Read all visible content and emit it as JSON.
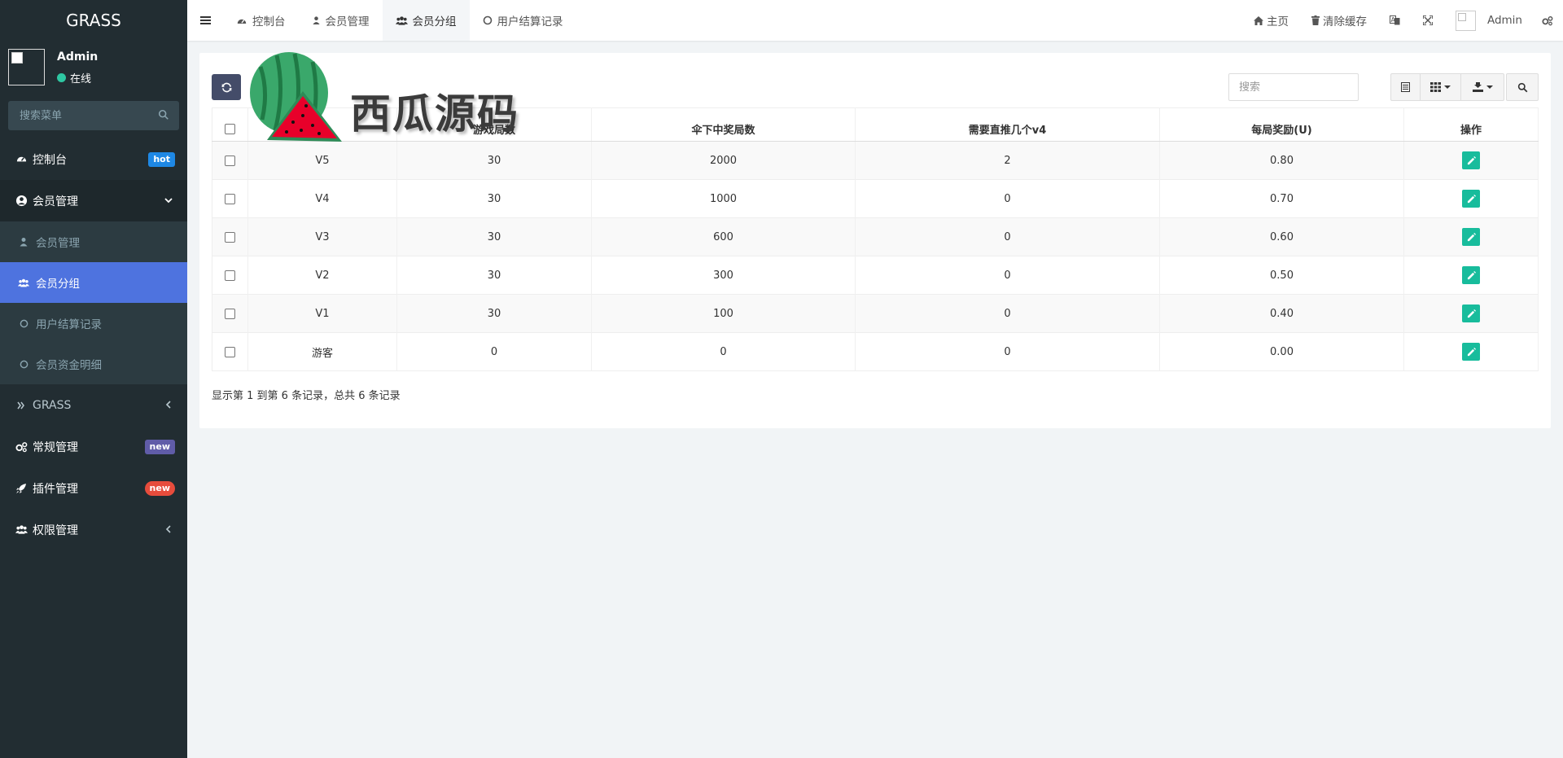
{
  "sidebar": {
    "logo": "GRASS",
    "user": {
      "name": "Admin",
      "status": "在线"
    },
    "search_placeholder": "搜索菜单",
    "items": {
      "dashboard": {
        "label": "控制台",
        "badge": "hot"
      },
      "member": {
        "label": "会员管理"
      },
      "member_sub": [
        {
          "label": "会员管理"
        },
        {
          "label": "会员分组"
        },
        {
          "label": "用户结算记录"
        },
        {
          "label": "会员资金明细"
        }
      ],
      "grass": {
        "label": "GRASS"
      },
      "general": {
        "label": "常规管理",
        "badge": "new"
      },
      "addon": {
        "label": "插件管理",
        "badge": "new"
      },
      "auth": {
        "label": "权限管理"
      }
    }
  },
  "header": {
    "tabs": [
      {
        "label": "控制台"
      },
      {
        "label": "会员管理"
      },
      {
        "label": "会员分组"
      },
      {
        "label": "用户结算记录"
      }
    ],
    "home": "主页",
    "clear_cache": "清除缓存",
    "admin": "Admin"
  },
  "toolbar": {
    "search_placeholder": "搜索"
  },
  "watermark": "西瓜源码",
  "table": {
    "headers": [
      "游戏局数",
      "伞下中奖局数",
      "需要直推几个v4",
      "每局奖励(U)",
      "操作"
    ],
    "rows": [
      {
        "name": "V5",
        "games": "30",
        "wins": "2000",
        "direct": "2",
        "reward": "0.80"
      },
      {
        "name": "V4",
        "games": "30",
        "wins": "1000",
        "direct": "0",
        "reward": "0.70"
      },
      {
        "name": "V3",
        "games": "30",
        "wins": "600",
        "direct": "0",
        "reward": "0.60"
      },
      {
        "name": "V2",
        "games": "30",
        "wins": "300",
        "direct": "0",
        "reward": "0.50"
      },
      {
        "name": "V1",
        "games": "30",
        "wins": "100",
        "direct": "0",
        "reward": "0.40"
      },
      {
        "name": "游客",
        "games": "0",
        "wins": "0",
        "direct": "0",
        "reward": "0.00"
      }
    ]
  },
  "pager": "显示第 1 到第 6 条记录，总共 6 条记录",
  "colors": {
    "sidebar": "#222d32",
    "active": "#4e73df",
    "edit": "#18bc9c",
    "refresh": "#444c69"
  }
}
